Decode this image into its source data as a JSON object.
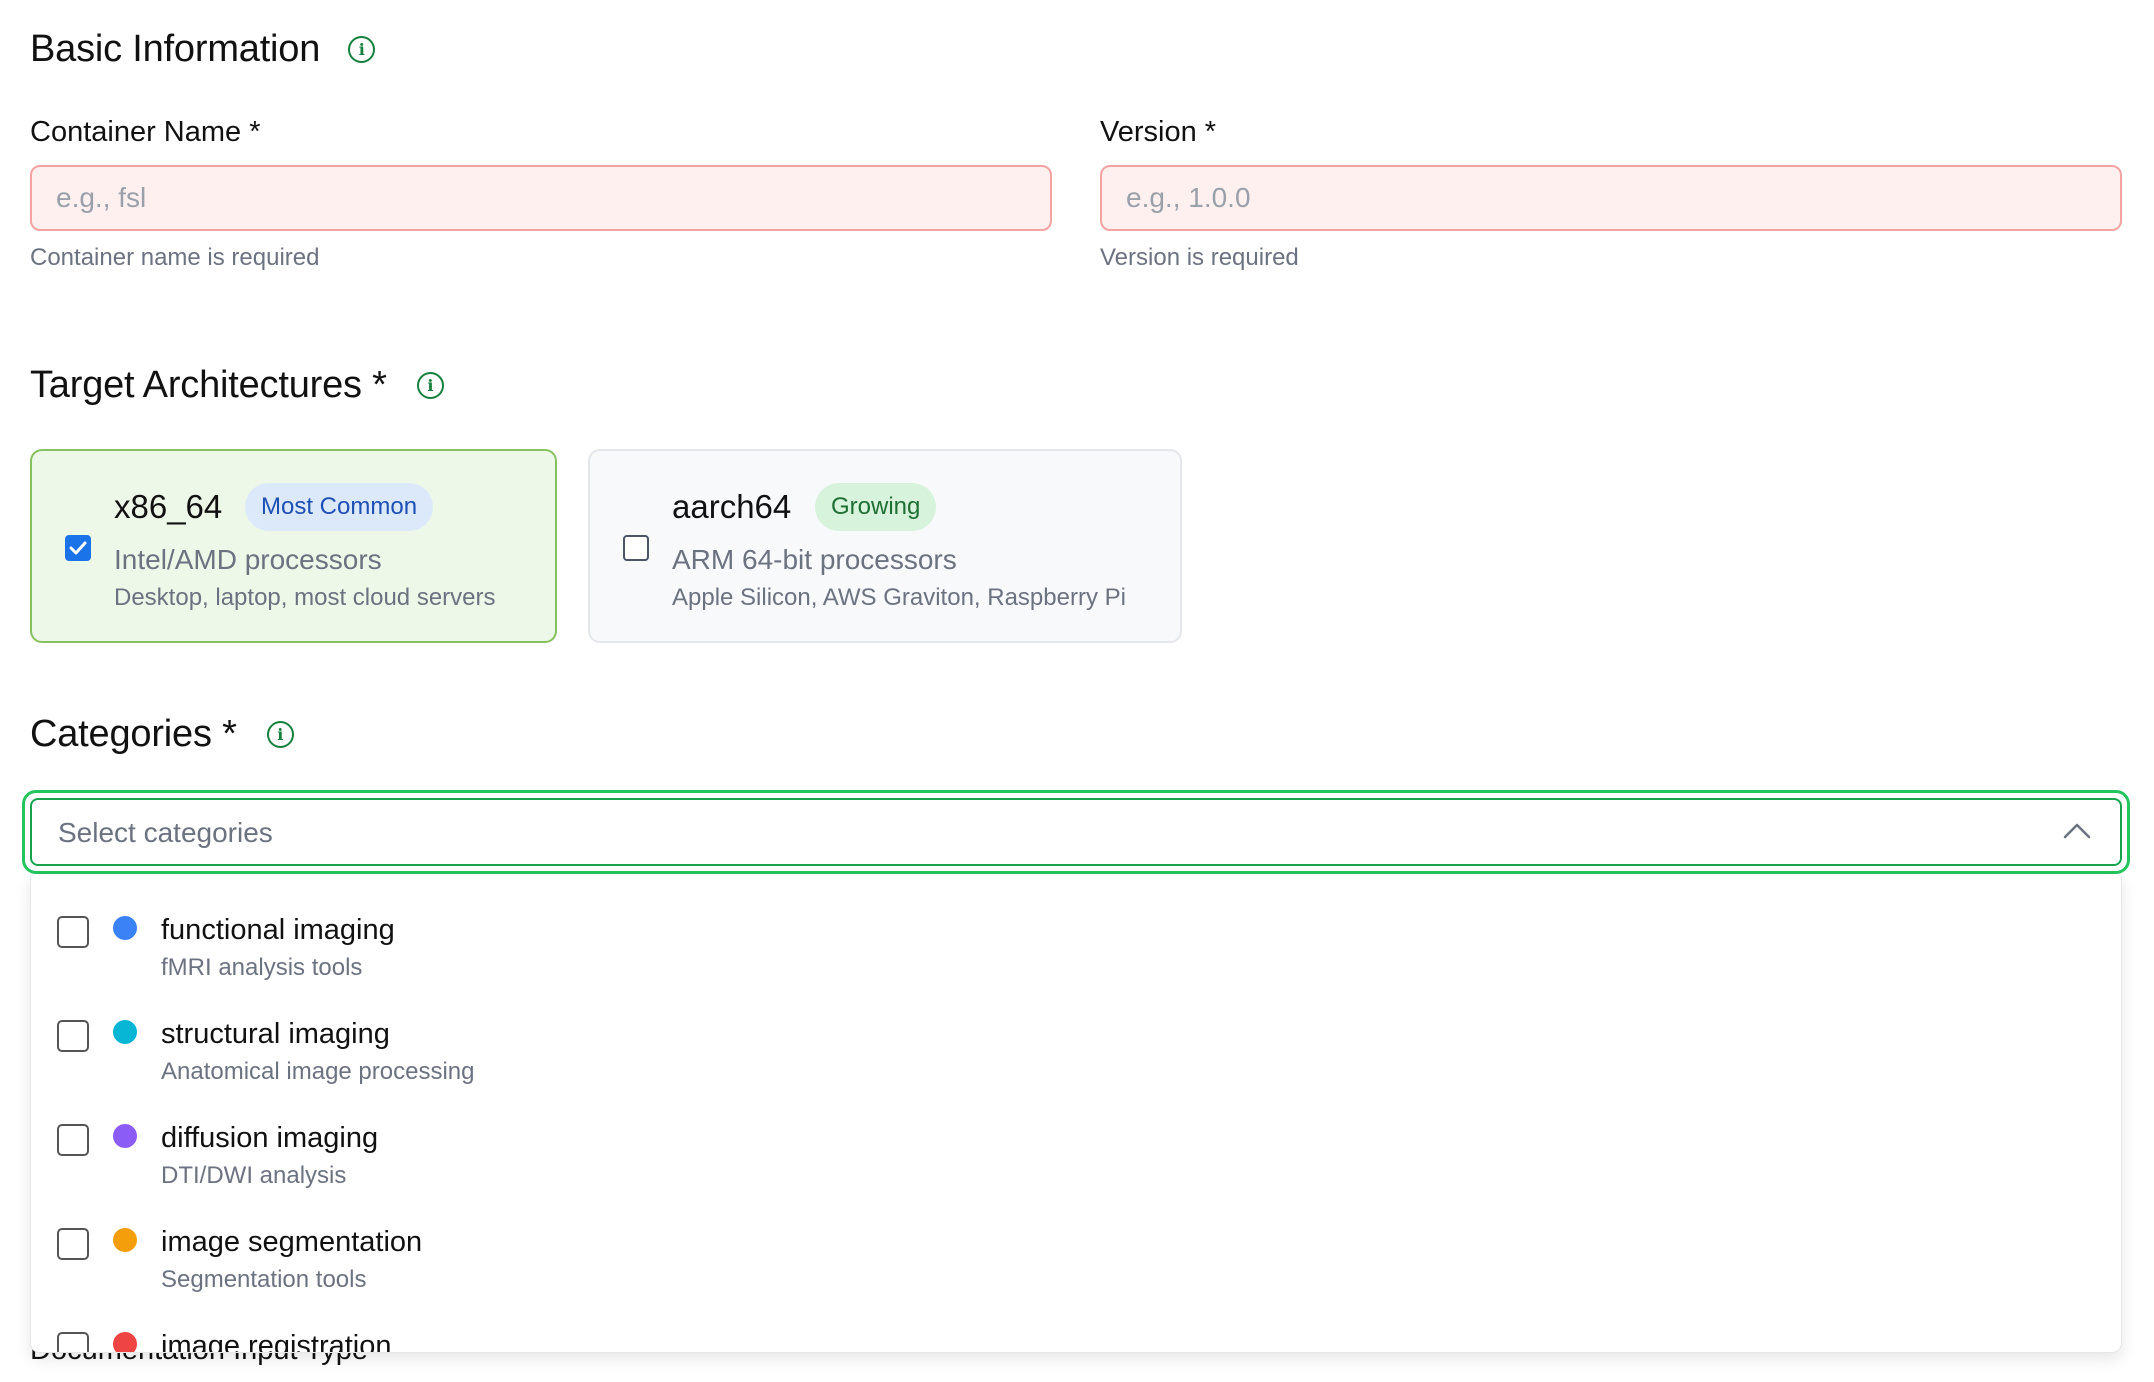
{
  "basic_info": {
    "title": "Basic Information",
    "container_name": {
      "label": "Container Name *",
      "placeholder": "e.g., fsl",
      "value": "",
      "error": "Container name is required"
    },
    "version": {
      "label": "Version *",
      "placeholder": "e.g., 1.0.0",
      "value": "",
      "error": "Version is required"
    }
  },
  "architectures": {
    "title": "Target Architectures *",
    "options": [
      {
        "name": "x86_64",
        "badge": "Most Common",
        "description": "Intel/AMD processors",
        "detail": "Desktop, laptop, most cloud servers",
        "checked": true
      },
      {
        "name": "aarch64",
        "badge": "Growing",
        "description": "ARM 64-bit processors",
        "detail": "Apple Silicon, AWS Graviton, Raspberry Pi",
        "checked": false
      }
    ]
  },
  "categories": {
    "title": "Categories *",
    "placeholder": "Select categories",
    "options": [
      {
        "name": "functional imaging",
        "description": "fMRI analysis tools",
        "color": "#3b82f6",
        "checked": false
      },
      {
        "name": "structural imaging",
        "description": "Anatomical image processing",
        "color": "#06b6d4",
        "checked": false
      },
      {
        "name": "diffusion imaging",
        "description": "DTI/DWI analysis",
        "color": "#8b5cf6",
        "checked": false
      },
      {
        "name": "image segmentation",
        "description": "Segmentation tools",
        "color": "#f59e0b",
        "checked": false
      },
      {
        "name": "image registration",
        "description": "",
        "color": "#ef4444",
        "checked": false
      }
    ]
  },
  "next_section_label": "Documentation Input Type",
  "icons": {
    "info": "info-circle-icon",
    "check": "checkmark-icon",
    "collapse": "chevron-up-icon"
  }
}
